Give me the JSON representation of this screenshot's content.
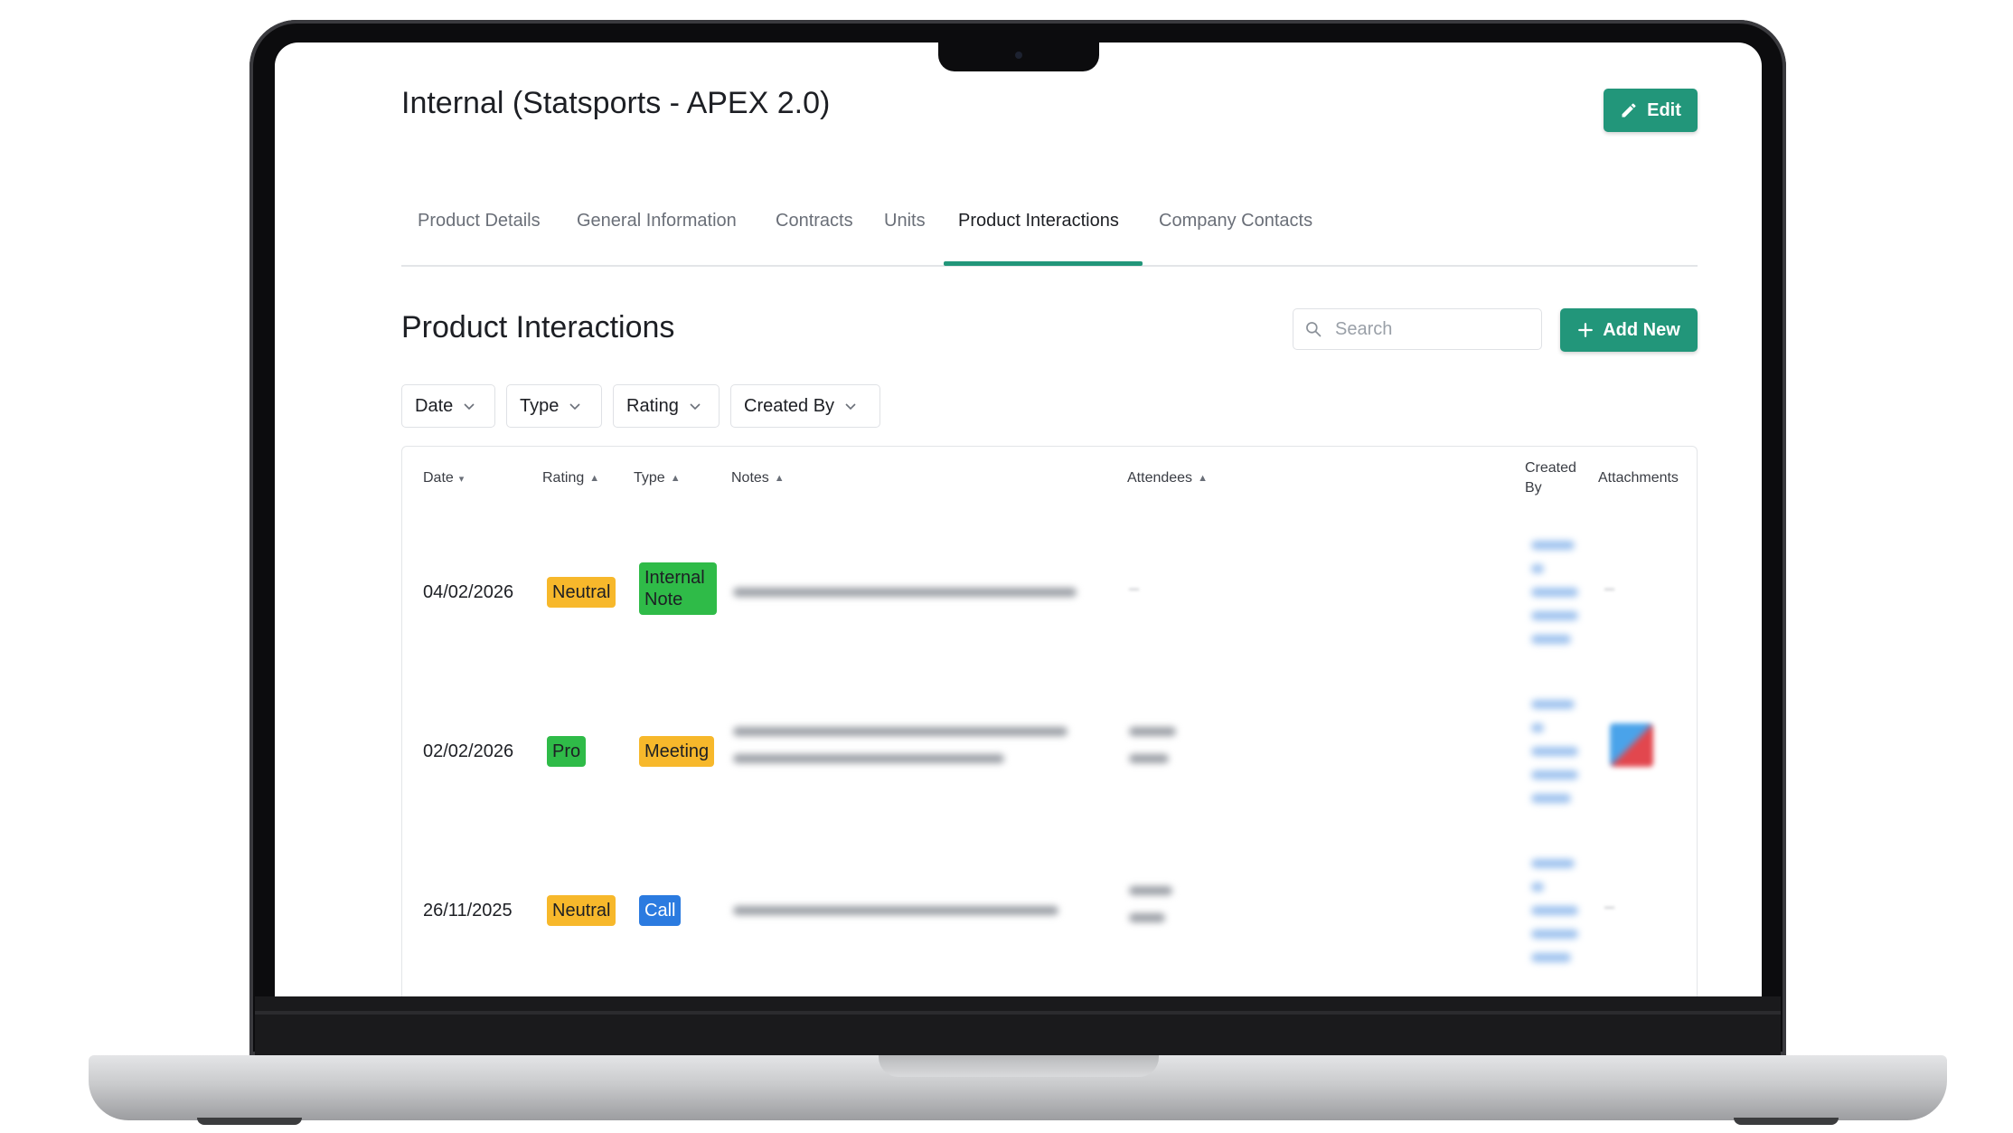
{
  "page": {
    "title": "Internal (Statsports - APEX 2.0)",
    "edit_label": "Edit"
  },
  "tabs": [
    {
      "label": "Product Details",
      "active": false
    },
    {
      "label": "General Information",
      "active": false
    },
    {
      "label": "Contracts",
      "active": false
    },
    {
      "label": "Units",
      "active": false
    },
    {
      "label": "Product Interactions",
      "active": true
    },
    {
      "label": "Company Contacts",
      "active": false
    }
  ],
  "section": {
    "title": "Product Interactions",
    "search_placeholder": "Search",
    "add_label": "Add New"
  },
  "filters": [
    "Date",
    "Type",
    "Rating",
    "Created By"
  ],
  "table": {
    "headers": {
      "date": "Date",
      "rating": "Rating",
      "type": "Type",
      "notes": "Notes",
      "attendees": "Attendees",
      "created_by_1": "Created",
      "created_by_2": "By",
      "attachments": "Attachments"
    },
    "rows": [
      {
        "date": "04/02/2026",
        "rating": "Neutral",
        "type_1": "Internal",
        "type_2": "Note"
      },
      {
        "date": "02/02/2026",
        "rating": "Pro",
        "type_1": "Meeting",
        "type_2": ""
      },
      {
        "date": "26/11/2025",
        "rating": "Neutral",
        "type_1": "Call",
        "type_2": ""
      }
    ]
  },
  "colors": {
    "accent": "#22967a",
    "neutral": "#f7b82b",
    "pro": "#2fbb48",
    "call": "#2b7be0"
  },
  "icons": {
    "edit": "pencil-icon",
    "add": "plus-icon",
    "search": "search-icon",
    "filter": "chevron-down-icon",
    "sort": "sort-icon"
  }
}
